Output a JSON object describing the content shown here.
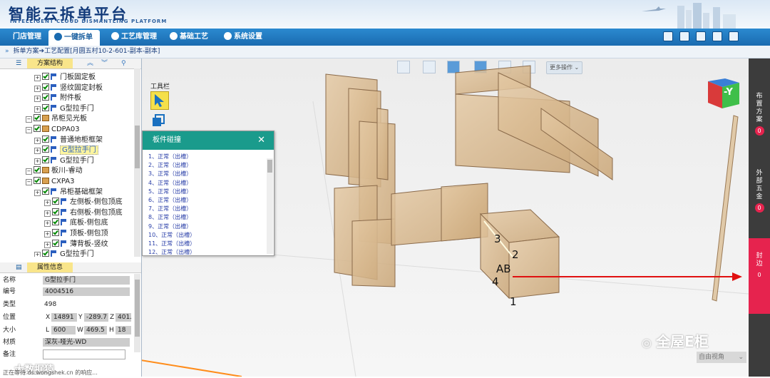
{
  "header": {
    "logo_title": "智能云拆单平台",
    "logo_subtitle": "INTELLIGENT CLOUD DISMANTLING PLATFORM"
  },
  "nav": {
    "items": [
      "门店管理",
      "一键拆单",
      "工艺库管理",
      "基础工艺",
      "系统设置"
    ],
    "active": "一键拆单"
  },
  "breadcrumb": {
    "item1": "拆单方案",
    "item2": "工艺配置[月圆五村10-2-601-副本-副本]"
  },
  "tree_panel": {
    "title": "方案结构",
    "rows": [
      {
        "label": "门板固定板",
        "type": "part"
      },
      {
        "label": "竖纹固定封板",
        "type": "part"
      },
      {
        "label": "附件板",
        "type": "part"
      },
      {
        "label": "G型拉手门",
        "type": "part"
      },
      {
        "label": "吊柜见光板",
        "type": "group"
      },
      {
        "label": "CDPA03",
        "type": "group"
      },
      {
        "label": "普通地柜框架",
        "type": "part"
      },
      {
        "label": "G型拉手门",
        "type": "part",
        "selected": true
      },
      {
        "label": "G型拉手门",
        "type": "part"
      },
      {
        "label": "板川-睿动",
        "type": "group"
      },
      {
        "label": "CXPA3",
        "type": "group"
      },
      {
        "label": "吊柜基础框架",
        "type": "part"
      },
      {
        "label": "左侧板-侧包顶底",
        "type": "part"
      },
      {
        "label": "右侧板-侧包顶底",
        "type": "part"
      },
      {
        "label": "底板-侧包底",
        "type": "part"
      },
      {
        "label": "顶板-侧包顶",
        "type": "part"
      },
      {
        "label": "薄背板-竖纹",
        "type": "part"
      },
      {
        "label": "G型拉手门",
        "type": "part"
      }
    ]
  },
  "props_panel": {
    "title": "属性信息",
    "name_label": "名称",
    "name_value": "G型拉手门",
    "code_label": "编号",
    "code_value": "4004516",
    "type_label": "类型",
    "type_value": "498",
    "pos_label": "位置",
    "pos_x": "14891",
    "pos_y": "-289.7",
    "pos_z": "401.5",
    "size_label": "大小",
    "size_l": "600",
    "size_w": "469.5",
    "size_h": "18",
    "material_label": "材质",
    "material_value": "深灰-哑光-WD",
    "note_label": "备注"
  },
  "viewport": {
    "tools_label": "工具栏",
    "more_label": "更多操作",
    "view_label": "自由视角",
    "axis_label": "-Y",
    "markers": [
      "3",
      "2",
      "AB",
      "4",
      "1"
    ]
  },
  "dialog": {
    "title": "板件碰撞",
    "items": [
      "1、正常（出槽）",
      "2、正常（出槽）",
      "3、正常（出槽）",
      "4、正常（出槽）",
      "5、正常（出槽）",
      "6、正常（出槽）",
      "7、正常（出槽）",
      "8、正常（出槽）",
      "9、正常（出槽）",
      "10、正常（出槽）",
      "11、正常（出槽）",
      "12、正常（出槽）"
    ]
  },
  "right_sidebar": {
    "groups": [
      {
        "label": "布置方案",
        "count": "0"
      },
      {
        "label": "外部五金",
        "count": "0"
      },
      {
        "label": "封边",
        "count": "0"
      }
    ]
  },
  "overlay": {
    "watermark": "全屋E柜",
    "status": "正在等待 ds.wongshek.cn 的响应...",
    "corner_logo": "大数据猿"
  },
  "colors": {
    "nav_blue": "#1a6bb0",
    "dialog_teal": "#1a9b8c",
    "badge_red": "#e6234e",
    "sidebar_dark": "#3c3c3c",
    "arrow_red": "#e01010"
  }
}
